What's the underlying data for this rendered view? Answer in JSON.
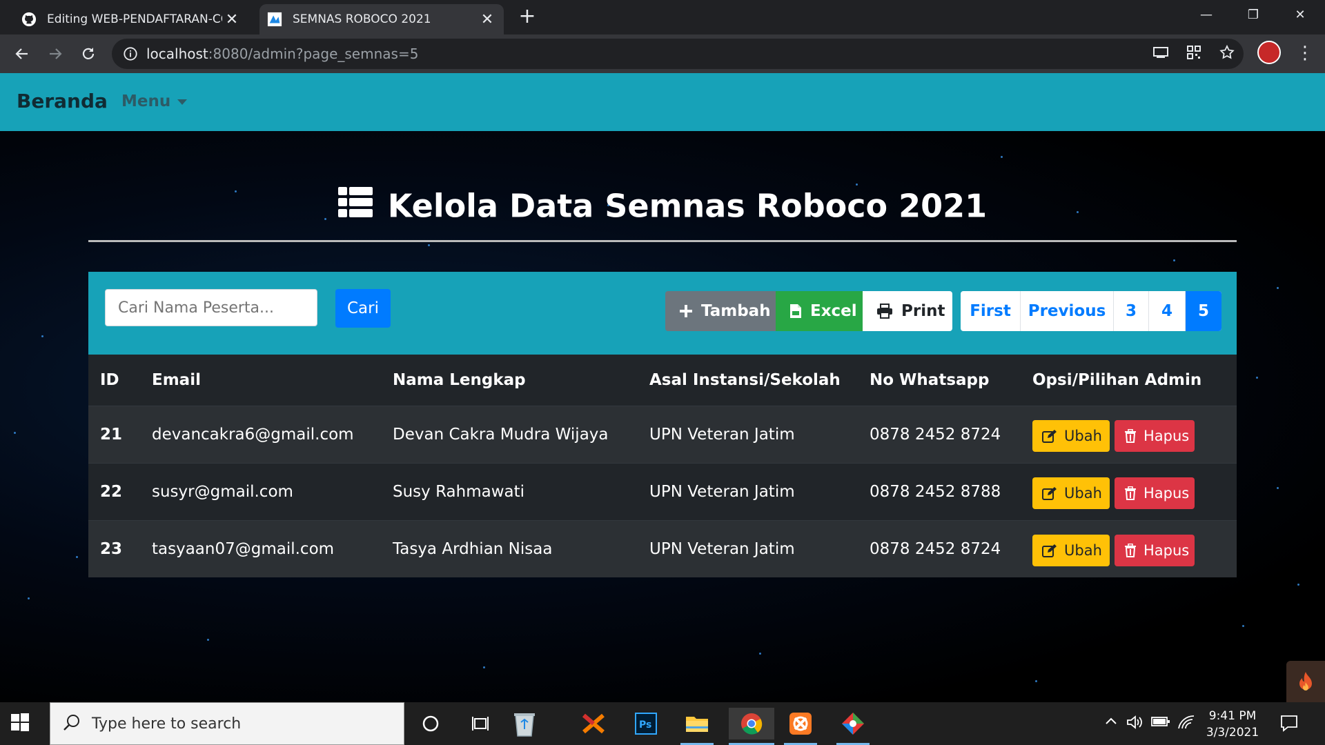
{
  "browser": {
    "tabs": [
      {
        "title": "Editing WEB-PENDAFTARAN-COI",
        "icon": "github-icon",
        "active": false
      },
      {
        "title": "SEMNAS ROBOCO 2021",
        "icon": "roboco-favicon",
        "active": true
      }
    ],
    "url_host": "localhost",
    "url_rest": ":8080/admin?page_semnas=5"
  },
  "navbar": {
    "brand": "Beranda",
    "menu": "Menu"
  },
  "page": {
    "title": "Kelola Data Semnas Roboco 2021"
  },
  "toolbar": {
    "search_placeholder": "Cari Nama Peserta...",
    "search_button": "Cari",
    "tambah": "Tambah",
    "excel": "Excel",
    "print": "Print"
  },
  "pagination": {
    "first": "First",
    "previous": "Previous",
    "pages": [
      "3",
      "4",
      "5"
    ],
    "current": "5"
  },
  "table": {
    "headers": [
      "ID",
      "Email",
      "Nama Lengkap",
      "Asal Instansi/Sekolah",
      "No Whatsapp",
      "Opsi/Pilihan Admin"
    ],
    "rows": [
      {
        "id": "21",
        "email": "devancakra6@gmail.com",
        "nama": "Devan Cakra Mudra Wijaya",
        "instansi": "UPN Veteran Jatim",
        "wa": "0878 2452 8724"
      },
      {
        "id": "22",
        "email": "susyr@gmail.com",
        "nama": "Susy Rahmawati",
        "instansi": "UPN Veteran Jatim",
        "wa": "0878 2452 8788"
      },
      {
        "id": "23",
        "email": "tasyaan07@gmail.com",
        "nama": "Tasya Ardhian Nisaa",
        "instansi": "UPN Veteran Jatim",
        "wa": "0878 2452 8724"
      }
    ],
    "ubah": "Ubah",
    "hapus": "Hapus"
  },
  "taskbar": {
    "search_placeholder": "Type here to search",
    "time": "9:41 PM",
    "date": "3/3/2021"
  },
  "colors": {
    "navbar": "#17a2b8",
    "primary": "#007bff",
    "success": "#28a745",
    "secondary": "#6c757d",
    "warning": "#ffc107",
    "danger": "#dc3545",
    "table_dark": "#212529"
  }
}
